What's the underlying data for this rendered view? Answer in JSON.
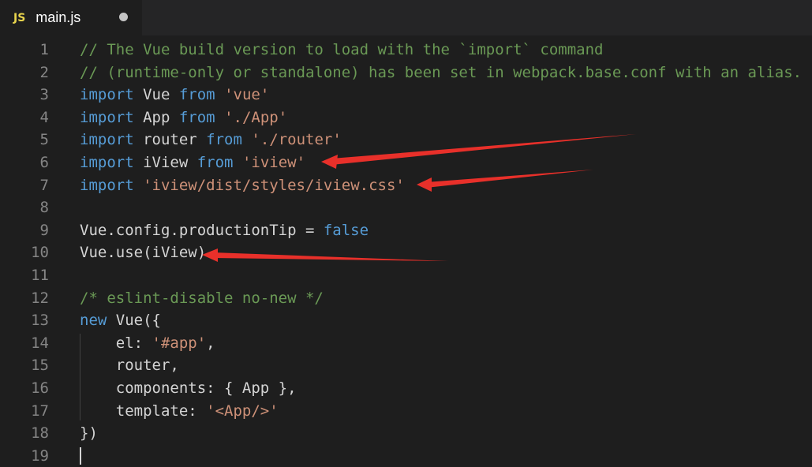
{
  "tab": {
    "icon": "JS",
    "filename": "main.js",
    "modified_icon": "unsaved-dot-icon"
  },
  "lines": [
    {
      "n": "1",
      "tokens": [
        {
          "t": "// The Vue build version to load with the `import` command",
          "c": "comment"
        }
      ]
    },
    {
      "n": "2",
      "tokens": [
        {
          "t": "// (runtime-only or standalone) has been set in webpack.base.conf with an alias.",
          "c": "comment"
        }
      ]
    },
    {
      "n": "3",
      "tokens": [
        {
          "t": "import",
          "c": "kw"
        },
        {
          "t": " Vue ",
          "c": "plain"
        },
        {
          "t": "from",
          "c": "kw"
        },
        {
          "t": " ",
          "c": "plain"
        },
        {
          "t": "'vue'",
          "c": "str"
        }
      ]
    },
    {
      "n": "4",
      "tokens": [
        {
          "t": "import",
          "c": "kw"
        },
        {
          "t": " App ",
          "c": "plain"
        },
        {
          "t": "from",
          "c": "kw"
        },
        {
          "t": " ",
          "c": "plain"
        },
        {
          "t": "'./App'",
          "c": "str"
        }
      ]
    },
    {
      "n": "5",
      "tokens": [
        {
          "t": "import",
          "c": "kw"
        },
        {
          "t": " router ",
          "c": "plain"
        },
        {
          "t": "from",
          "c": "kw"
        },
        {
          "t": " ",
          "c": "plain"
        },
        {
          "t": "'./router'",
          "c": "str"
        }
      ]
    },
    {
      "n": "6",
      "tokens": [
        {
          "t": "import",
          "c": "kw"
        },
        {
          "t": " iView ",
          "c": "plain"
        },
        {
          "t": "from",
          "c": "kw"
        },
        {
          "t": " ",
          "c": "plain"
        },
        {
          "t": "'iview'",
          "c": "str"
        }
      ]
    },
    {
      "n": "7",
      "tokens": [
        {
          "t": "import",
          "c": "kw"
        },
        {
          "t": " ",
          "c": "plain"
        },
        {
          "t": "'iview/dist/styles/iview.css'",
          "c": "str"
        }
      ]
    },
    {
      "n": "8",
      "tokens": []
    },
    {
      "n": "9",
      "tokens": [
        {
          "t": "Vue.config.productionTip = ",
          "c": "plain"
        },
        {
          "t": "false",
          "c": "kw"
        }
      ]
    },
    {
      "n": "10",
      "tokens": [
        {
          "t": "Vue.use(iView)",
          "c": "plain"
        }
      ]
    },
    {
      "n": "11",
      "tokens": []
    },
    {
      "n": "12",
      "tokens": [
        {
          "t": "/* eslint-disable no-new */",
          "c": "comment"
        }
      ]
    },
    {
      "n": "13",
      "tokens": [
        {
          "t": "new",
          "c": "kw"
        },
        {
          "t": " Vue({",
          "c": "plain"
        }
      ]
    },
    {
      "n": "14",
      "tokens": [
        {
          "t": "    el: ",
          "c": "plain"
        },
        {
          "t": "'#app'",
          "c": "str"
        },
        {
          "t": ",",
          "c": "plain"
        }
      ]
    },
    {
      "n": "15",
      "tokens": [
        {
          "t": "    router,",
          "c": "plain"
        }
      ]
    },
    {
      "n": "16",
      "tokens": [
        {
          "t": "    components: { App },",
          "c": "plain"
        }
      ]
    },
    {
      "n": "17",
      "tokens": [
        {
          "t": "    template: ",
          "c": "plain"
        },
        {
          "t": "'<App/>'",
          "c": "str"
        }
      ]
    },
    {
      "n": "18",
      "tokens": [
        {
          "t": "})",
          "c": "plain"
        }
      ]
    },
    {
      "n": "19",
      "tokens": []
    }
  ],
  "colors": {
    "comment": "#6a9955",
    "keyword": "#569cd6",
    "string": "#ce9178",
    "text": "#d4d4d4",
    "line_number": "#858585",
    "arrow": "#e8302a"
  },
  "annotations": [
    "annotation-arrow-line-6",
    "annotation-arrow-line-7",
    "annotation-arrow-line-10"
  ]
}
